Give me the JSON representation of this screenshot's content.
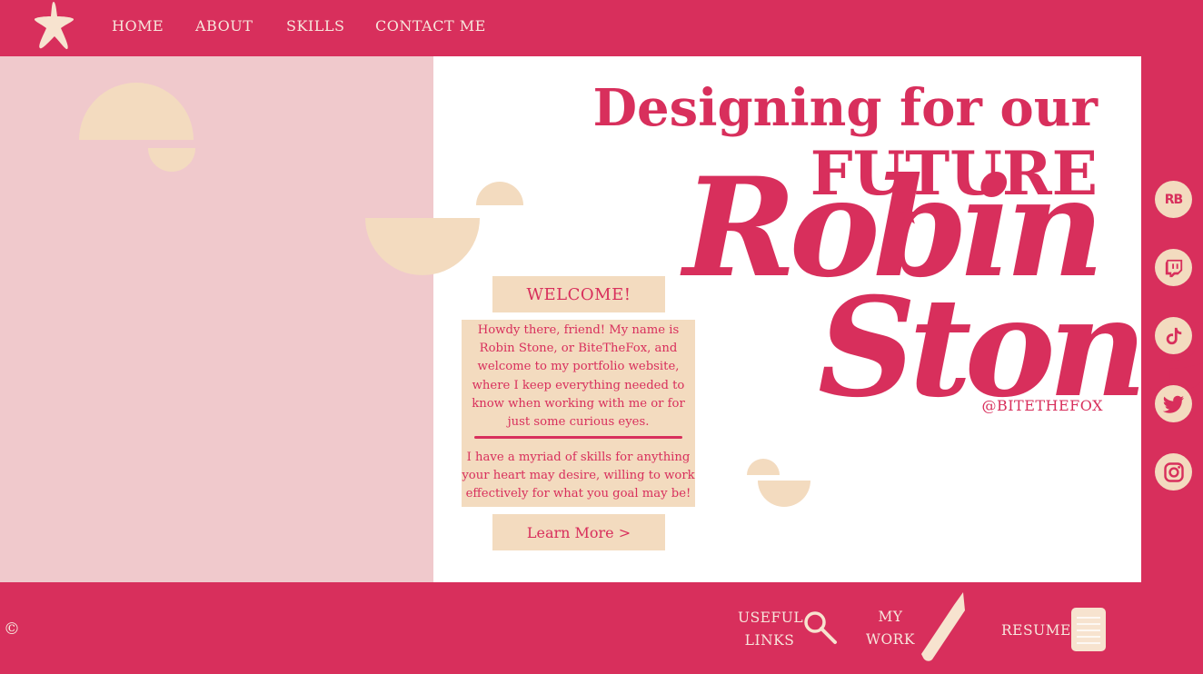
{
  "nav": {
    "home": "HOME",
    "about": "ABOUT",
    "skills": "SKILLS",
    "contact": "CONTACT ME"
  },
  "hero": {
    "line1": "Designing for our",
    "line2": "FUTURE",
    "name_first": "Robin",
    "name_last": "Stone",
    "handle": "@BITETHEFOX"
  },
  "intro": {
    "welcome": "WELCOME!",
    "paragraph1": "Howdy there, friend! My name is Robin Stone, or BiteTheFox, and welcome to my portfolio website, where I keep everything needed to know when working with me or for just some curious eyes.",
    "paragraph2": "I have a myriad of skills for anything your heart may desire, willing to work effectively for what you goal may be!",
    "learn_more": "Learn More >"
  },
  "social": {
    "redbubble_text": "RB",
    "icons": [
      "redbubble-icon",
      "twitch-icon",
      "tiktok-icon",
      "twitter-icon",
      "instagram-icon"
    ]
  },
  "footer": {
    "copyright": "©",
    "useful_links_1": "USEFUL",
    "useful_links_2": "LINKS",
    "my_work_1": "MY",
    "my_work_2": "WORK",
    "resume": "RESUME"
  },
  "colors": {
    "brand": "#d82f5c",
    "cream": "#f3dbbf",
    "pink_panel": "#f0c9cc",
    "white": "#ffffff"
  }
}
